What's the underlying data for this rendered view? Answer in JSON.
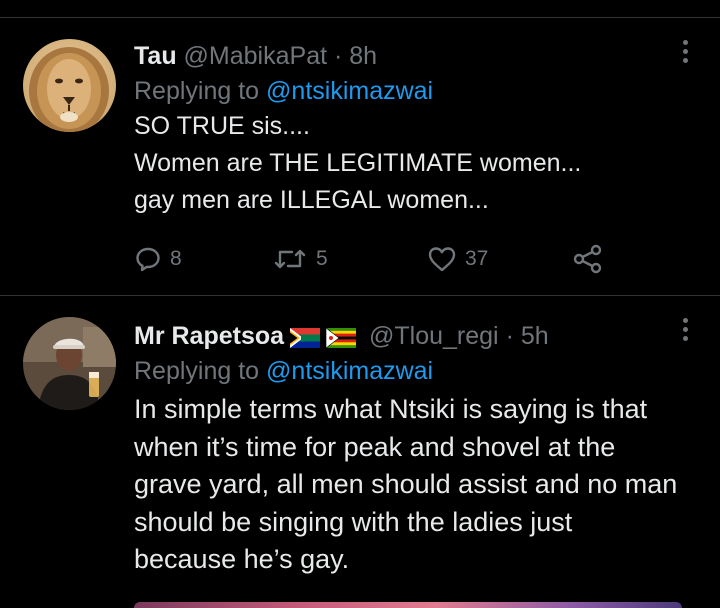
{
  "tweets": [
    {
      "name": "Tau",
      "handle": "@MabikaPat",
      "separator": "·",
      "time": "8h",
      "replying_prefix": "Replying to",
      "replying_to": "@ntsikimazwai",
      "text_lines": [
        "SO TRUE sis....",
        "Women are THE LEGITIMATE women...",
        "gay men are ILLEGAL women..."
      ],
      "stats": {
        "replies": "8",
        "retweets": "5",
        "likes": "37"
      }
    },
    {
      "name": "Mr Rapetsoa",
      "handle": "@Tlou_regi",
      "separator": "·",
      "time": "5h",
      "replying_prefix": "Replying to",
      "replying_to": "@ntsikimazwai",
      "text_lines": [
        "In simple terms what Ntsiki is saying is that",
        "when it’s time for peak and shovel at the",
        "grave yard, all men should assist and no man",
        "should be singing with the ladies just",
        "because he’s gay."
      ]
    }
  ],
  "icons": {
    "more": "more-dots-icon",
    "reply": "reply-icon",
    "retweet": "retweet-icon",
    "like": "heart-icon",
    "share": "share-icon",
    "flags": [
      "south-africa-flag-icon",
      "zimbabwe-flag-icon"
    ]
  },
  "colors": {
    "background": "#000000",
    "text": "#e7e9ea",
    "muted": "#71767b",
    "accent": "#1d9bf0"
  }
}
